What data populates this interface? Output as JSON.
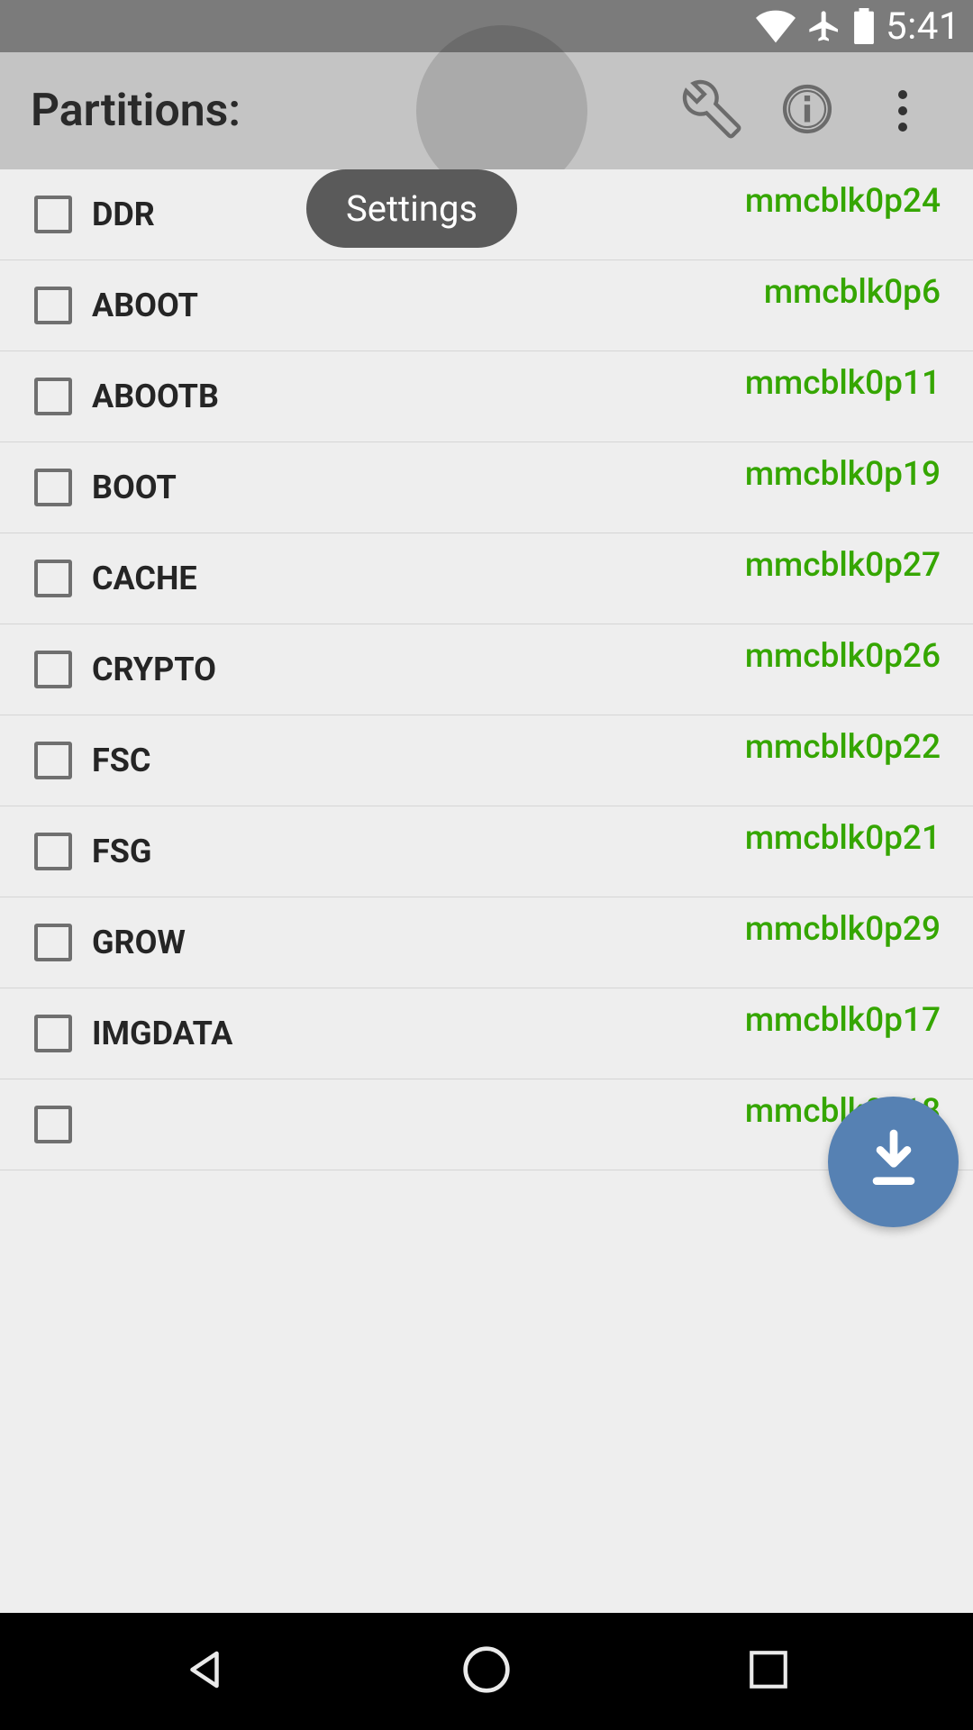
{
  "status_bar": {
    "time": "5:41"
  },
  "app_bar": {
    "title": "Partitions:"
  },
  "tooltip": {
    "label": "Settings"
  },
  "partitions": [
    {
      "name": "DDR",
      "dev": "mmcblk0p24"
    },
    {
      "name": "ABOOT",
      "dev": "mmcblk0p6"
    },
    {
      "name": "ABOOTB",
      "dev": "mmcblk0p11"
    },
    {
      "name": "BOOT",
      "dev": "mmcblk0p19"
    },
    {
      "name": "CACHE",
      "dev": "mmcblk0p27"
    },
    {
      "name": "CRYPTO",
      "dev": "mmcblk0p26"
    },
    {
      "name": "FSC",
      "dev": "mmcblk0p22"
    },
    {
      "name": "FSG",
      "dev": "mmcblk0p21"
    },
    {
      "name": "GROW",
      "dev": "mmcblk0p29"
    },
    {
      "name": "IMGDATA",
      "dev": "mmcblk0p17"
    },
    {
      "name": "",
      "dev": "mmcblk0p18"
    }
  ]
}
